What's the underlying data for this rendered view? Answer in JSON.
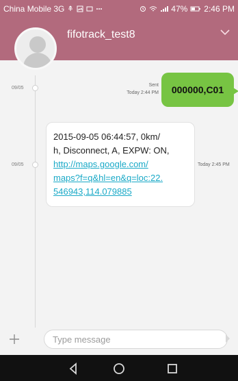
{
  "statusbar": {
    "carrier": "China Mobile 3G",
    "battery": "47%",
    "time": "2:46 PM",
    "icons": [
      "usb-icon",
      "image-icon",
      "message-icon",
      "more-icon",
      "alarm-icon",
      "wifi-icon",
      "signal-icon",
      "battery-icon"
    ]
  },
  "header": {
    "contact_name": "fifotrack_test8",
    "accent": "#b26a7d"
  },
  "messages": [
    {
      "date": "09/05",
      "direction": "sent",
      "status": "Sent",
      "time": "Today 2:44 PM",
      "text": "000000,C01"
    },
    {
      "date": "09/05",
      "direction": "received",
      "time": "Today 2:45 PM",
      "lines": [
        "2015-09-05 06:44:57, 0km/",
        "h, Disconnect, A, EXPW: ON,"
      ],
      "link_lines": [
        "http://maps.google.com/",
        "maps?f=q&hl=en&q=loc:22.",
        "546943,114.079885"
      ]
    }
  ],
  "composer": {
    "placeholder": "Type message"
  },
  "navbar": {
    "back": "back-icon",
    "home": "home-icon",
    "recents": "recents-icon"
  },
  "colors": {
    "sent_bubble": "#77c443",
    "link": "#19a9c7"
  }
}
